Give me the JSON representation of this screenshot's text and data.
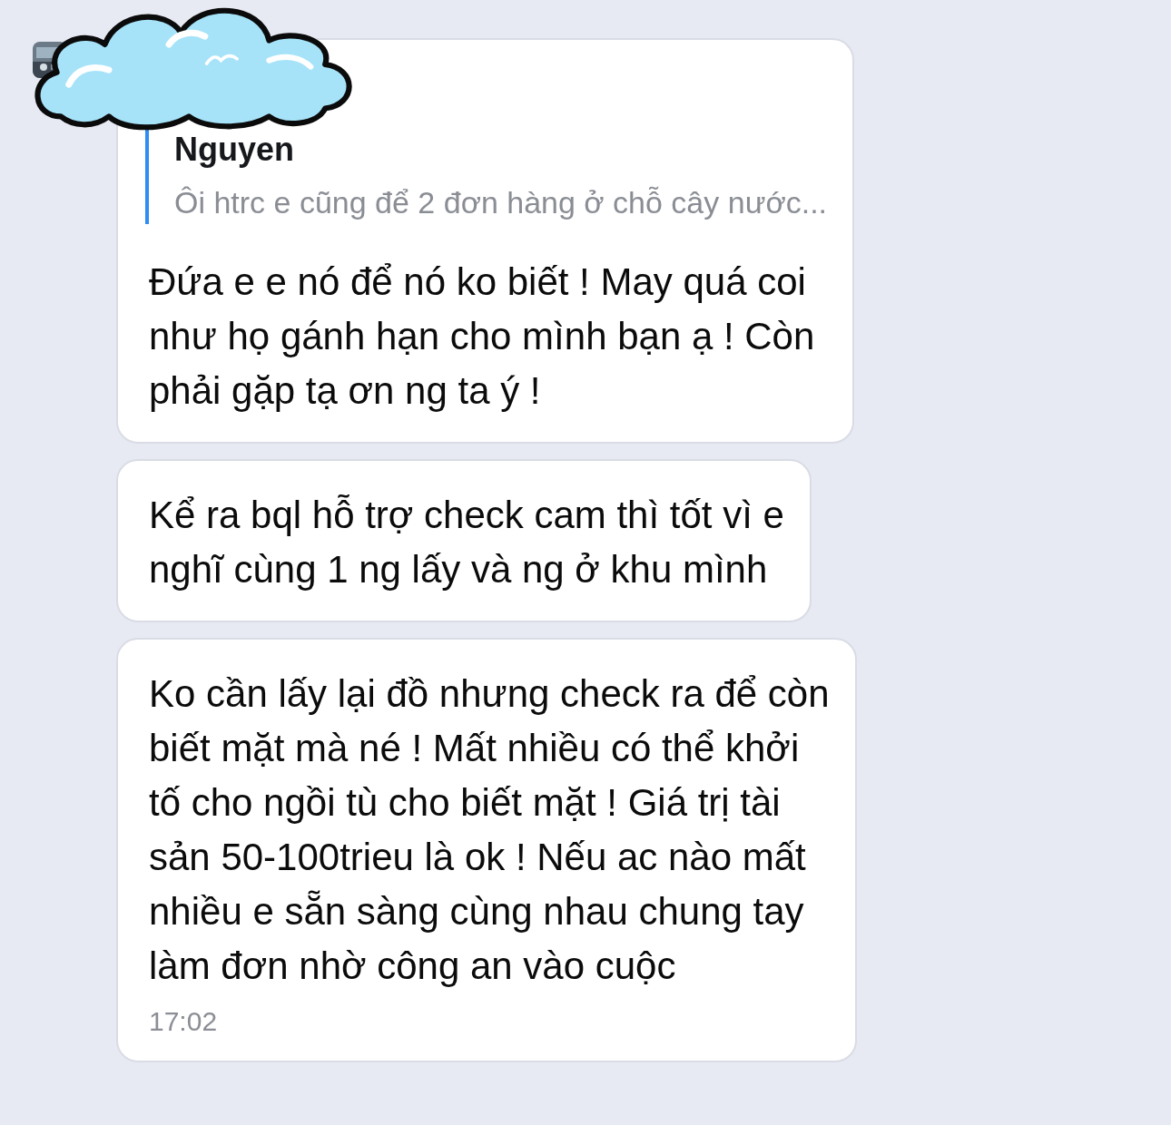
{
  "messages": [
    {
      "kind": "reply",
      "quote": {
        "author": "Nguyen",
        "text": "Ôi htrc e cũng để 2 đơn hàng ở chỗ cây nước..."
      },
      "text": "Đứa e e nó để nó ko biết ! May quá coi\nnhư họ gánh hạn cho mình bạn ạ ! Còn\nphải gặp tạ ơn ng ta ý !"
    },
    {
      "kind": "plain",
      "text": "Kể ra bql hỗ trợ check cam thì tốt vì e\nnghĩ cùng 1 ng lấy và ng ở khu mình"
    },
    {
      "kind": "plain",
      "text": "Ko cần lấy lại đồ nhưng check ra để còn\nbiết mặt mà né ! Mất nhiều có thể khởi\ntố cho ngồi tù cho biết mặt ! Giá trị tài\nsản 50-100trieu là ok ! Nếu ac nào mất\nnhiều e sẵn sàng cùng nhau chung tay\nlàm đơn nhờ công an vào cuộc",
      "time": "17:02"
    }
  ]
}
